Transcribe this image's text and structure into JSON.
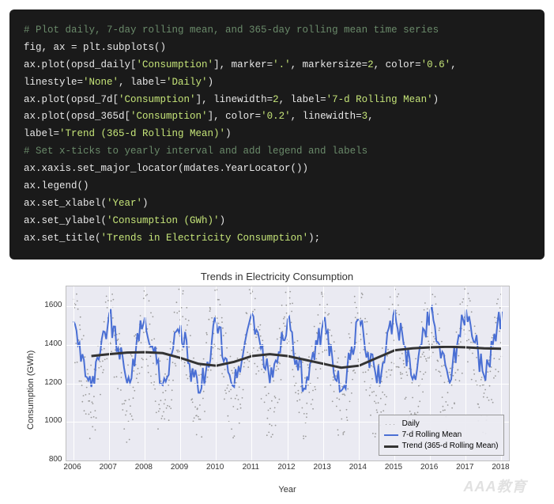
{
  "code": {
    "lines": [
      {
        "t": "comment",
        "text": "# Plot daily, 7-day rolling mean, and 365-day rolling mean time series"
      },
      {
        "t": "plain",
        "text": "fig, ax = plt.subplots()"
      },
      {
        "t": "mixed",
        "parts": [
          "ax.plot(opsd_daily[",
          {
            "s": "'Consumption'"
          },
          "], marker=",
          {
            "s": "'.'"
          },
          ", markersize=",
          {
            "n": "2"
          },
          ", color=",
          {
            "s": "'0.6'"
          },
          ","
        ]
      },
      {
        "t": "mixed",
        "parts": [
          "linestyle=",
          {
            "s": "'None'"
          },
          ", label=",
          {
            "s": "'Daily'"
          },
          ")"
        ]
      },
      {
        "t": "mixed",
        "parts": [
          "ax.plot(opsd_7d[",
          {
            "s": "'Consumption'"
          },
          "], linewidth=",
          {
            "n": "2"
          },
          ", label=",
          {
            "s": "'7-d Rolling Mean'"
          },
          ")"
        ]
      },
      {
        "t": "mixed",
        "parts": [
          "ax.plot(opsd_365d[",
          {
            "s": "'Consumption'"
          },
          "], color=",
          {
            "s": "'0.2'"
          },
          ", linewidth=",
          {
            "n": "3"
          },
          ","
        ]
      },
      {
        "t": "mixed",
        "parts": [
          "label=",
          {
            "s": "'Trend (365-d Rolling Mean)'"
          },
          ")"
        ]
      },
      {
        "t": "comment",
        "text": "# Set x-ticks to yearly interval and add legend and labels"
      },
      {
        "t": "plain",
        "text": "ax.xaxis.set_major_locator(mdates.YearLocator())"
      },
      {
        "t": "plain",
        "text": "ax.legend()"
      },
      {
        "t": "mixed",
        "parts": [
          "ax.set_xlabel(",
          {
            "s": "'Year'"
          },
          ")"
        ]
      },
      {
        "t": "mixed",
        "parts": [
          "ax.set_ylabel(",
          {
            "s": "'Consumption (GWh)'"
          },
          ")"
        ]
      },
      {
        "t": "mixed",
        "parts": [
          "ax.set_title(",
          {
            "s": "'Trends in Electricity Consumption'"
          },
          ");"
        ]
      }
    ]
  },
  "chart_data": {
    "type": "line",
    "title": "Trends in Electricity Consumption",
    "xlabel": "Year",
    "ylabel": "Consumption (GWh)",
    "ylim": [
      800,
      1700
    ],
    "yticks": [
      800,
      1000,
      1200,
      1400,
      1600
    ],
    "xticks": [
      2006,
      2007,
      2008,
      2009,
      2010,
      2011,
      2012,
      2013,
      2014,
      2015,
      2016,
      2017,
      2018
    ],
    "xlim": [
      2005.8,
      2018.2
    ],
    "legend": [
      "Daily",
      "7-d Rolling Mean",
      "Trend (365-d Rolling Mean)"
    ],
    "series": [
      {
        "name": "Trend (365-d Rolling Mean)",
        "color": "#333333",
        "width": 3,
        "x": [
          2006.5,
          2007,
          2007.5,
          2008,
          2008.5,
          2009,
          2009.5,
          2010,
          2010.5,
          2011,
          2011.5,
          2012,
          2012.5,
          2013,
          2013.5,
          2014,
          2014.5,
          2015,
          2015.5,
          2016,
          2016.5,
          2017,
          2017.5,
          2018
        ],
        "y": [
          1340,
          1350,
          1358,
          1360,
          1355,
          1330,
          1300,
          1290,
          1310,
          1340,
          1350,
          1340,
          1320,
          1300,
          1280,
          1290,
          1330,
          1370,
          1380,
          1385,
          1388,
          1385,
          1380,
          1378
        ]
      },
      {
        "name": "7-d Rolling Mean",
        "color": "#4a6fd4",
        "width": 2,
        "x": [
          2006,
          2006.25,
          2006.5,
          2006.75,
          2007,
          2007.25,
          2007.5,
          2007.75,
          2008,
          2008.25,
          2008.5,
          2008.75,
          2009,
          2009.25,
          2009.5,
          2009.75,
          2010,
          2010.25,
          2010.5,
          2010.75,
          2011,
          2011.25,
          2011.5,
          2011.75,
          2012,
          2012.25,
          2012.5,
          2012.75,
          2013,
          2013.25,
          2013.5,
          2013.75,
          2014,
          2014.25,
          2014.5,
          2014.75,
          2015,
          2015.25,
          2015.5,
          2015.75,
          2016,
          2016.25,
          2016.5,
          2016.75,
          2017,
          2017.25,
          2017.5,
          2017.75,
          2018
        ],
        "y": [
          1520,
          1350,
          1180,
          1360,
          1560,
          1380,
          1200,
          1380,
          1540,
          1360,
          1190,
          1350,
          1500,
          1300,
          1150,
          1310,
          1510,
          1330,
          1180,
          1350,
          1560,
          1380,
          1200,
          1360,
          1530,
          1320,
          1170,
          1320,
          1520,
          1330,
          1160,
          1320,
          1530,
          1360,
          1200,
          1370,
          1580,
          1400,
          1220,
          1400,
          1580,
          1400,
          1230,
          1400,
          1580,
          1410,
          1240,
          1400,
          1570
        ]
      }
    ],
    "scatter": {
      "name": "Daily",
      "color": "#999999",
      "note": "dense cloud 2006..2018, y roughly 900..1700",
      "count_hint": 4400
    }
  },
  "watermark": "AAA教育"
}
